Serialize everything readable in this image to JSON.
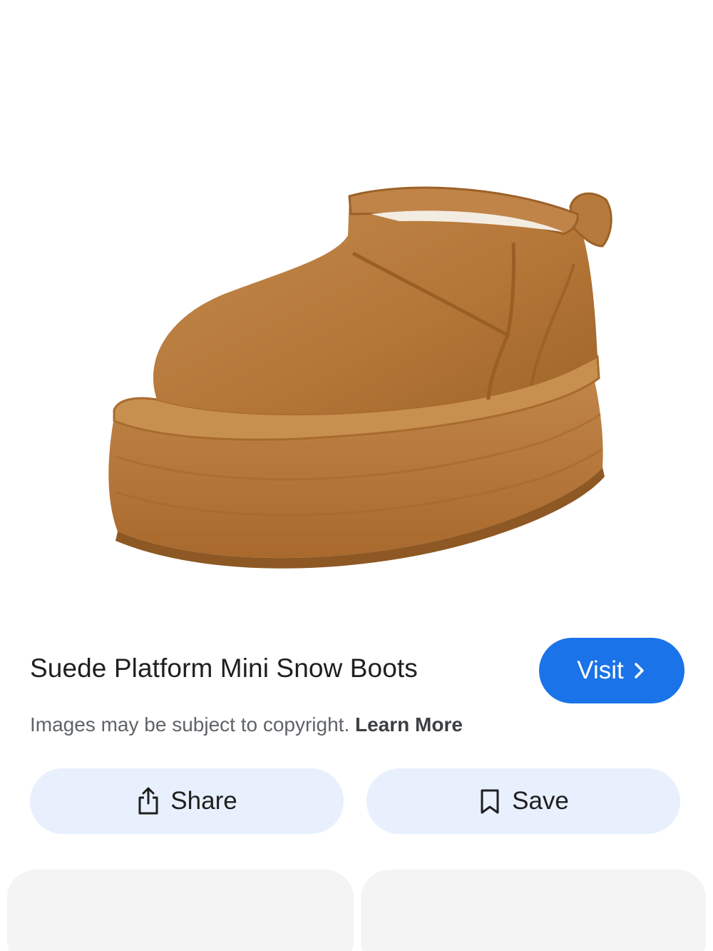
{
  "product": {
    "image_alt": "Chestnut suede platform mini snow boot",
    "title": "Suede Platform Mini Snow Boots"
  },
  "visit": {
    "label": "Visit",
    "icon": "chevron-right-icon"
  },
  "copyright": {
    "notice": "Images may be subject to copyright.",
    "learn_more": "Learn More"
  },
  "actions": {
    "share": {
      "label": "Share",
      "icon": "share-icon"
    },
    "save": {
      "label": "Save",
      "icon": "bookmark-icon"
    }
  },
  "colors": {
    "accent": "#1a73e8",
    "action_bg": "#e8f0fe",
    "card_bg": "#f4f4f5",
    "boot": "#b97c3e"
  }
}
